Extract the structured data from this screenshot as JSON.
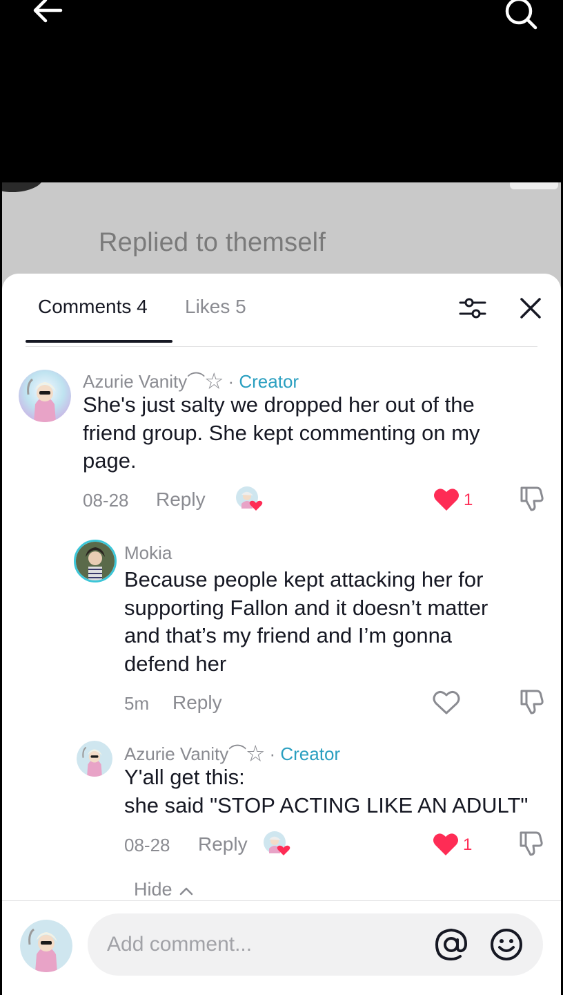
{
  "header": {
    "back_icon": "arrow-left-icon",
    "search_icon": "search-icon"
  },
  "preview": {
    "text": "Replied to themself"
  },
  "sheet": {
    "tabs": [
      {
        "label": "Comments 4"
      },
      {
        "label": "Likes 5"
      }
    ],
    "filter_icon": "sliders-icon",
    "close_icon": "close-icon"
  },
  "comments": [
    {
      "username": "Azurie Vanity⌒☆",
      "separator": " · ",
      "badge": "Creator",
      "text_lines": [
        "She's just salty we dropped her out of the",
        "friend group. She kept commenting on my",
        "page."
      ],
      "date": "08-28",
      "reply_label": "Reply",
      "likes": "1",
      "liked": true
    },
    {
      "username": "Mokia",
      "text_lines": [
        "Because people kept attacking her for",
        "supporting Fallon and it doesn’t matter",
        "and that’s my friend and I’m gonna",
        "defend her"
      ],
      "date": "5m",
      "reply_label": "Reply",
      "liked": false
    },
    {
      "username": "Azurie Vanity⌒☆",
      "separator": " · ",
      "badge": "Creator",
      "text_lines": [
        "Y'all get this:",
        "she said \"STOP ACTING LIKE AN ADULT\""
      ],
      "date": "08-28",
      "reply_label": "Reply",
      "likes": "1",
      "liked": true
    }
  ],
  "hide_label": "Hide",
  "composer": {
    "placeholder": "Add comment...",
    "at_icon": "at-icon",
    "emoji_icon": "emoji-icon"
  },
  "colors": {
    "accent_creator": "#2a9fc0",
    "like_red": "#fe2c55",
    "text_primary": "#161823",
    "text_secondary": "#8a8b91"
  }
}
